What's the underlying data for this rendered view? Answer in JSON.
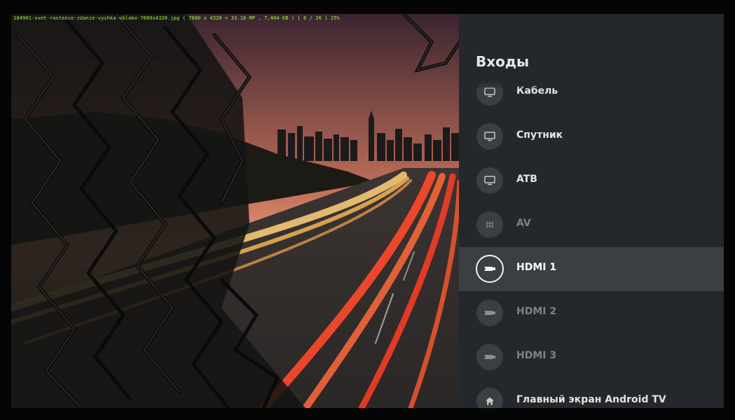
{
  "osd": {
    "file_info": "104901-svet-rastenie-zdanie-vyshka-oblako-7680x4320.jpg  ( 7680 x 4320 = 33.18 MP , 7,404 KB )  [ 6 / 26 ]  25%"
  },
  "panel": {
    "title": "Входы",
    "items": [
      {
        "label": "Кабель",
        "icon": "tv-icon"
      },
      {
        "label": "Спутник",
        "icon": "tv-icon"
      },
      {
        "label": "ATB",
        "icon": "tv-icon"
      },
      {
        "label": "AV",
        "icon": "av-icon"
      },
      {
        "label": "HDMI 1",
        "icon": "hdmi-icon"
      },
      {
        "label": "HDMI 2",
        "icon": "hdmi-icon"
      },
      {
        "label": "HDMI 3",
        "icon": "hdmi-icon"
      },
      {
        "label": "Главный экран Android TV",
        "icon": "home-icon"
      }
    ]
  },
  "colors": {
    "panel_bg": "#24282c",
    "selected_bg": "#3a3f44",
    "osd_text": "#9bff3a"
  }
}
